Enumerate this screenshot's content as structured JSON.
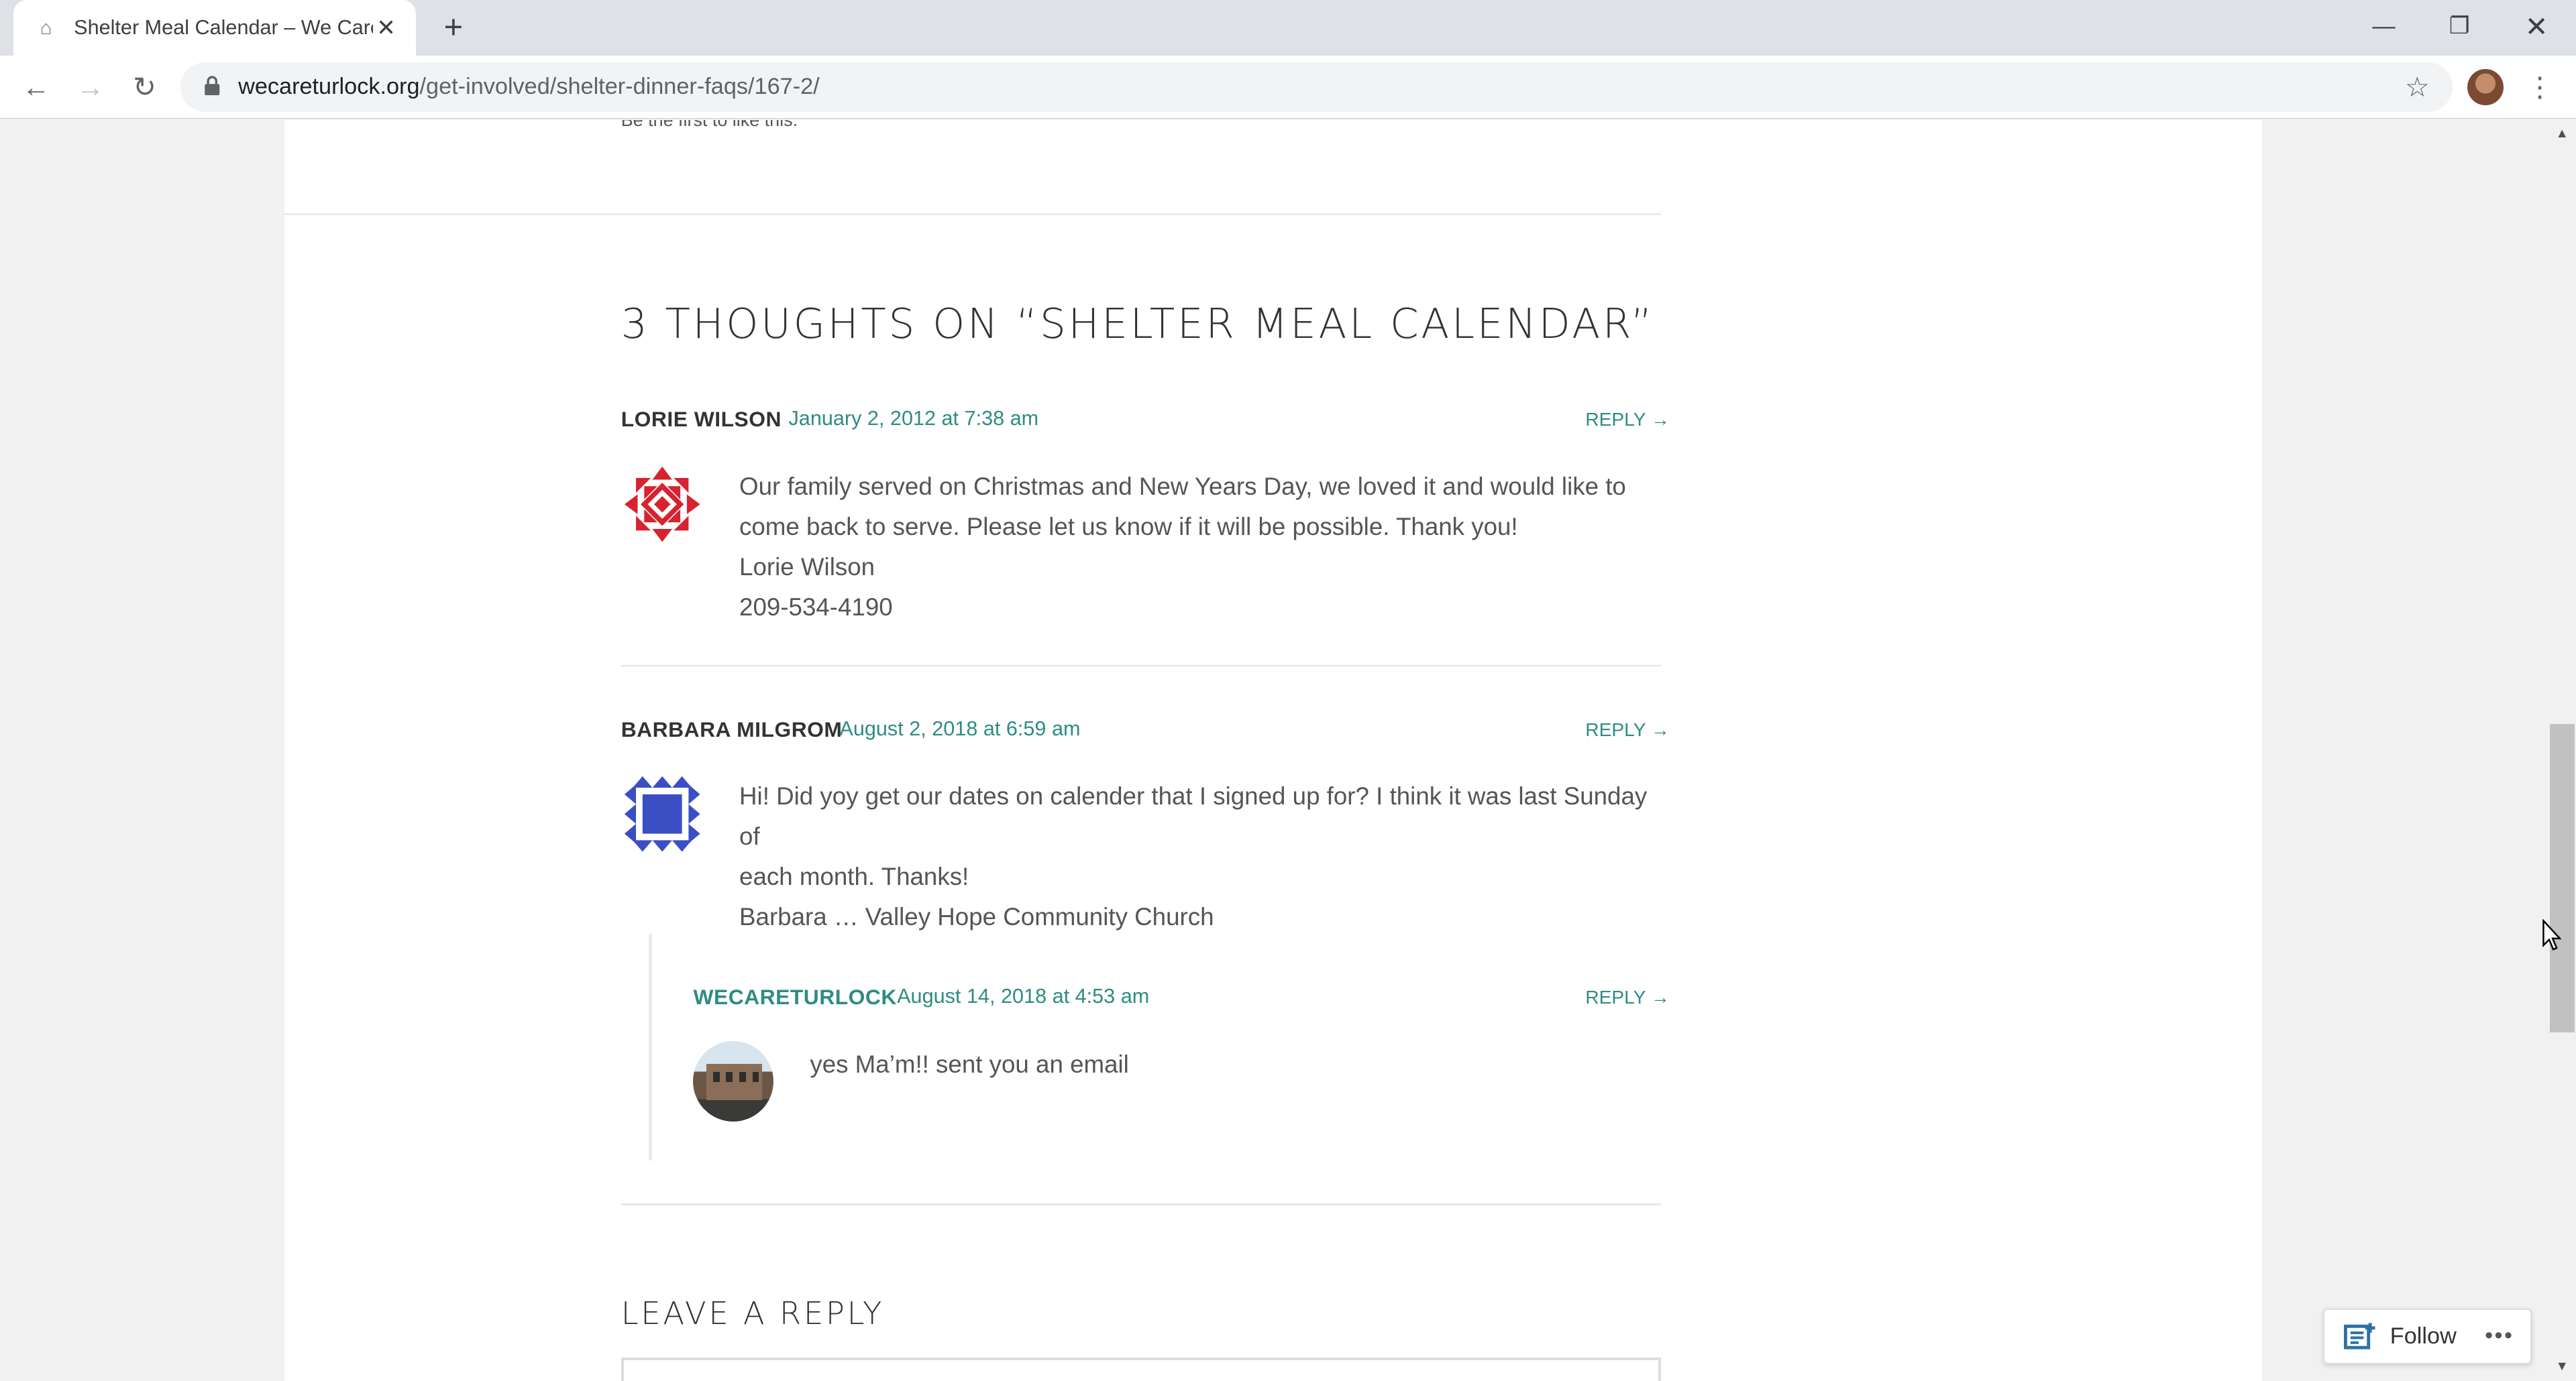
{
  "browser": {
    "tab_title": "Shelter Meal Calendar – We Care",
    "url_domain": "wecareturlock.org",
    "url_path": "/get-involved/shelter-dinner-faqs/167-2/"
  },
  "page": {
    "cut_text": "Be the first to like this.",
    "heading": "3 THOUGHTS ON “SHELTER MEAL CALENDAR”",
    "comments": [
      {
        "author": "LORIE WILSON",
        "date": "January 2, 2012 at 7:38 am",
        "reply": "REPLY →",
        "lines": [
          "Our family served on Christmas and New Years Day, we loved it and would like to",
          "come back to serve. Please let us know if it will be possible. Thank you!",
          "Lorie Wilson",
          "209-534-4190"
        ]
      },
      {
        "author": "BARBARA MILGROM",
        "date": "August 2, 2018 at 6:59 am",
        "reply": "REPLY →",
        "lines": [
          "Hi! Did yoy get our dates on calender that I signed up for? I think it was last Sunday of",
          "each month. Thanks!",
          "Barbara … Valley Hope Community Church"
        ]
      },
      {
        "author": "WECARETURLOCK",
        "date": "August 14, 2018 at 4:53 am",
        "reply": "REPLY →",
        "lines": [
          "yes Ma’m!! sent you an email"
        ]
      }
    ],
    "leave_reply": "LEAVE A REPLY"
  },
  "follow": {
    "label": "Follow",
    "more": "•••"
  },
  "colors": {
    "accent": "#2e8c84",
    "gravatar_red": "#d8222f",
    "gravatar_blue": "#3b4fc4"
  }
}
